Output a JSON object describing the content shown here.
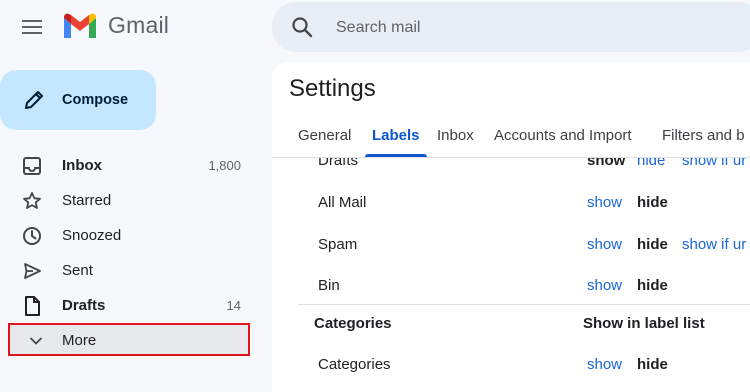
{
  "header": {
    "brand": "Gmail",
    "search_placeholder": "Search mail"
  },
  "compose": {
    "label": "Compose"
  },
  "sidebar": {
    "items": [
      {
        "label": "Inbox",
        "count": "1,800",
        "bold": true
      },
      {
        "label": "Starred",
        "count": ""
      },
      {
        "label": "Snoozed",
        "count": ""
      },
      {
        "label": "Sent",
        "count": ""
      },
      {
        "label": "Drafts",
        "count": "14",
        "bold": true
      },
      {
        "label": "More",
        "count": "",
        "highlighted": true
      }
    ]
  },
  "settings": {
    "title": "Settings",
    "tabs": [
      "General",
      "Labels",
      "Inbox",
      "Accounts and Import",
      "Filters and b"
    ],
    "active_tab": "Labels",
    "rows": [
      {
        "name": "Drafts",
        "show": "show",
        "hide": "hide",
        "unread": "show if ur"
      },
      {
        "name": "All Mail",
        "show": "show",
        "hide": "hide"
      },
      {
        "name": "Spam",
        "show": "show",
        "hide": "hide",
        "unread": "show if ur"
      },
      {
        "name": "Bin",
        "show": "show",
        "hide": "hide"
      },
      {
        "name": "Categories",
        "show": "show",
        "hide": "hide"
      }
    ],
    "section_heading": "Categories",
    "section_column": "Show in label list"
  },
  "colors": {
    "accent": "#0b57d0",
    "link": "#1a66d8",
    "compose_bg": "#c2e7ff",
    "highlight_border": "#e0141e"
  }
}
